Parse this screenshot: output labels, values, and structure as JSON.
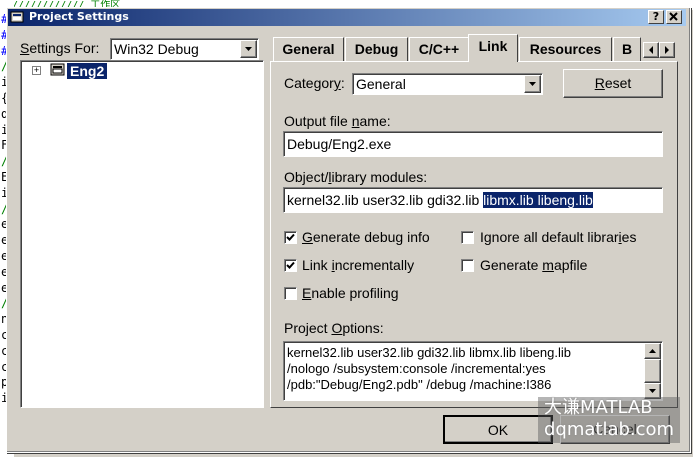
{
  "window": {
    "title": "Project Settings",
    "help_btn": "?",
    "close_btn": "X",
    "editor_top_text": "//////////////   工作区"
  },
  "editor_chars": [
    "#",
    "#",
    "#",
    "/",
    "i",
    "{",
    "d",
    "i",
    "F",
    "/",
    "E",
    "i",
    "/",
    "e",
    "e",
    "e",
    "e",
    "e",
    "/",
    "n",
    "c",
    "c",
    "c",
    "p",
    "i"
  ],
  "settings_for": {
    "label": "Settings For:",
    "value": "Win32 Debug"
  },
  "tree": {
    "expander": "+",
    "item": "Eng2"
  },
  "tabs": [
    {
      "label": "General",
      "active": false
    },
    {
      "label": "Debug",
      "active": false
    },
    {
      "label": "C/C++",
      "active": false
    },
    {
      "label": "Link",
      "active": true
    },
    {
      "label": "Resources",
      "active": false
    },
    {
      "label": "B",
      "active": false
    }
  ],
  "category": {
    "label": "Category:",
    "value": "General",
    "reset_btn": "Reset"
  },
  "output": {
    "label": "Output file name:",
    "value": "Debug/Eng2.exe"
  },
  "modules": {
    "label": "Object/library modules:",
    "value_plain": "kernel32.lib user32.lib gdi32.lib ",
    "value_selected": "libmx.lib libeng.lib"
  },
  "options": {
    "generate_debug": {
      "label": "Generate debug info",
      "checked": true
    },
    "link_incrementally": {
      "label": "Link incrementally",
      "checked": true
    },
    "enable_profiling": {
      "label": "Enable profiling",
      "checked": false
    },
    "ignore_defaults": {
      "label": "Ignore all default libraries",
      "checked": false
    },
    "generate_mapfile": {
      "label": "Generate mapfile",
      "checked": false
    }
  },
  "project_options": {
    "label": "Project Options:",
    "lines": [
      "kernel32.lib user32.lib gdi32.lib libmx.lib libeng.lib",
      "/nologo /subsystem:console /incremental:yes",
      "/pdb:\"Debug/Eng2.pdb\" /debug /machine:I386"
    ]
  },
  "buttons": {
    "ok": "OK",
    "cancel": "Cancel"
  },
  "watermark": {
    "line1": "大谦MATLAB",
    "line2": "dqmatlab.com"
  }
}
